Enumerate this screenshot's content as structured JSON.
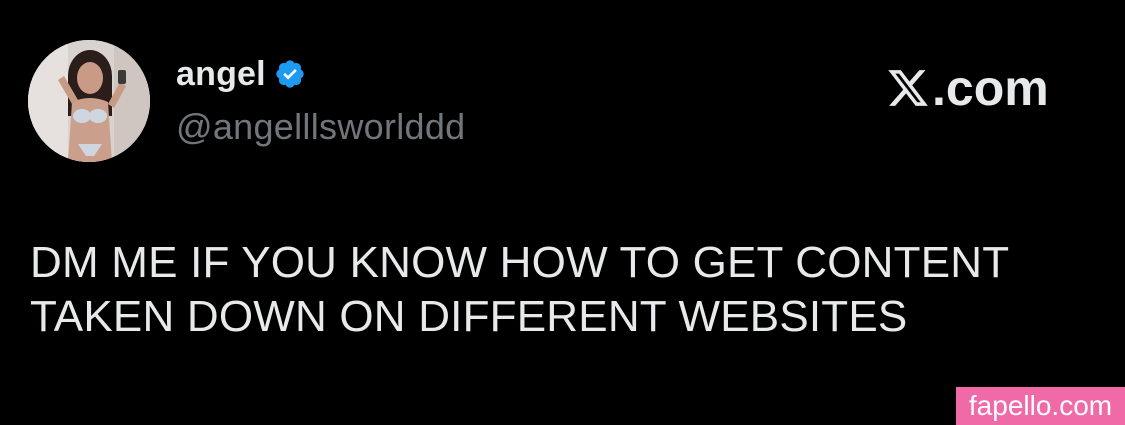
{
  "profile": {
    "display_name": "angel",
    "handle": "@angelllsworlddd",
    "verified": true,
    "verified_icon": "verified-badge-icon",
    "avatar_icon": "profile-photo"
  },
  "brand": {
    "logo_icon": "x-logo-icon",
    "suffix": ".com"
  },
  "tweet": {
    "lines": [
      "DM ME IF YOU KNOW HOW TO GET CONTENT",
      "TAKEN DOWN ON DIFFERENT WEBSITES"
    ]
  },
  "watermark": {
    "text": "fapello.com"
  },
  "colors": {
    "background": "#000000",
    "text_primary": "#e7e9ea",
    "text_secondary": "#71767b",
    "verified_blue": "#1d9bf0",
    "watermark_pink": "#f06aa8"
  }
}
